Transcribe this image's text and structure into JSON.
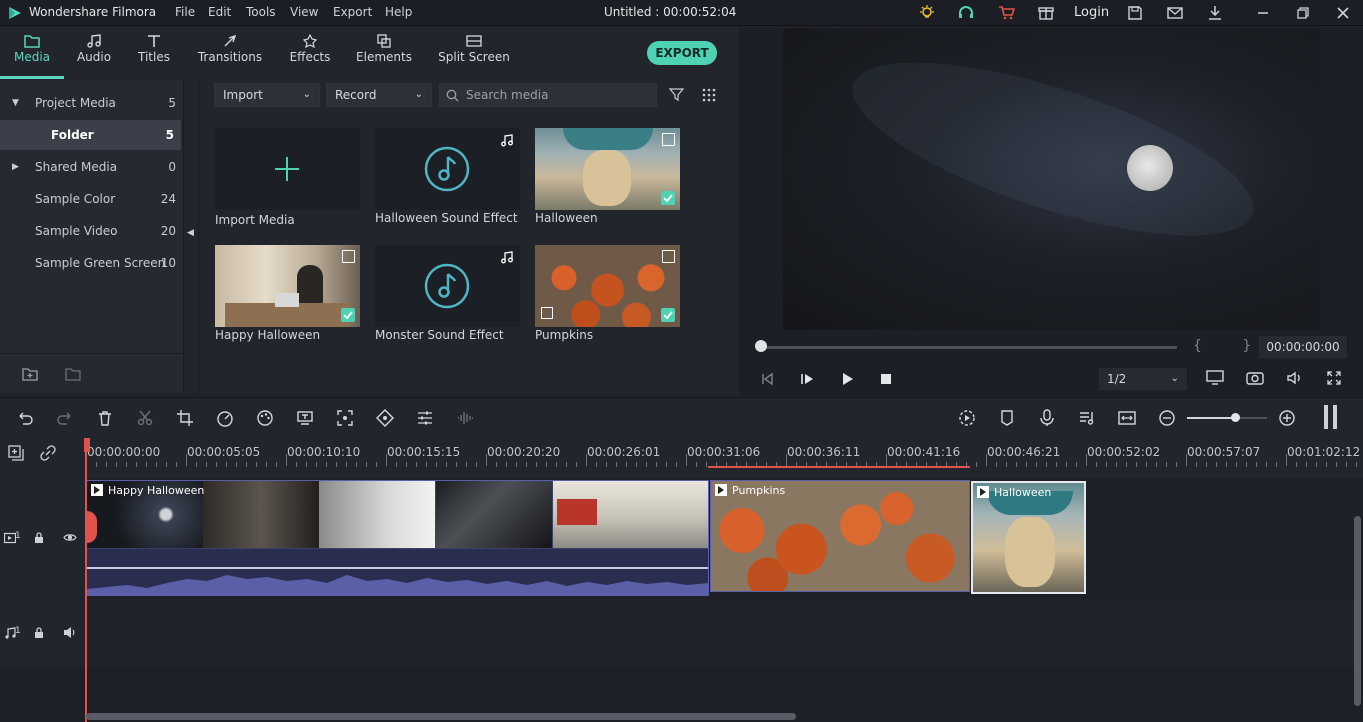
{
  "app": {
    "name": "Wondershare Filmora",
    "title": "Untitled : 00:00:52:04",
    "login": "Login"
  },
  "menu": [
    "File",
    "Edit",
    "Tools",
    "View",
    "Export",
    "Help"
  ],
  "tabs": [
    {
      "label": "Media",
      "icon": "folder-icon"
    },
    {
      "label": "Audio",
      "icon": "music-note-icon"
    },
    {
      "label": "Titles",
      "icon": "text-icon"
    },
    {
      "label": "Transitions",
      "icon": "transition-icon"
    },
    {
      "label": "Effects",
      "icon": "effects-icon"
    },
    {
      "label": "Elements",
      "icon": "elements-icon"
    },
    {
      "label": "Split Screen",
      "icon": "split-screen-icon"
    }
  ],
  "export_label": "EXPORT",
  "tree": [
    {
      "label": "Project Media",
      "count": "5"
    },
    {
      "label": "Folder",
      "count": "5"
    },
    {
      "label": "Shared Media",
      "count": "0"
    },
    {
      "label": "Sample Color",
      "count": "24"
    },
    {
      "label": "Sample Video",
      "count": "20"
    },
    {
      "label": "Sample Green Screen",
      "count": "10"
    }
  ],
  "media_toolbar": {
    "import": "Import",
    "record": "Record",
    "search_placeholder": "Search media"
  },
  "media_items": [
    {
      "label": "Import Media"
    },
    {
      "label": "Halloween Sound Effect"
    },
    {
      "label": "Halloween"
    },
    {
      "label": "Happy Halloween"
    },
    {
      "label": "Monster Sound Effect"
    },
    {
      "label": "Pumpkins"
    }
  ],
  "preview": {
    "timecode": "00:00:00:00",
    "ratio": "1/2",
    "brace": "{ }"
  },
  "ruler": [
    "00:00:00:00",
    "00:00:05:05",
    "00:00:10:10",
    "00:00:15:15",
    "00:00:20:20",
    "00:00:26:01",
    "00:00:31:06",
    "00:00:36:11",
    "00:00:41:16",
    "00:00:46:21",
    "00:00:52:02",
    "00:00:57:07",
    "00:01:02:12"
  ],
  "clips": [
    {
      "label": "Happy Halloween"
    },
    {
      "label": "Pumpkins"
    },
    {
      "label": "Halloween"
    }
  ],
  "track_labels": {
    "video": "1",
    "audio": "1"
  },
  "colors": {
    "accent": "#4fd1b4",
    "playhead": "#e0524b",
    "audio_wave": "#5a5fa8"
  }
}
